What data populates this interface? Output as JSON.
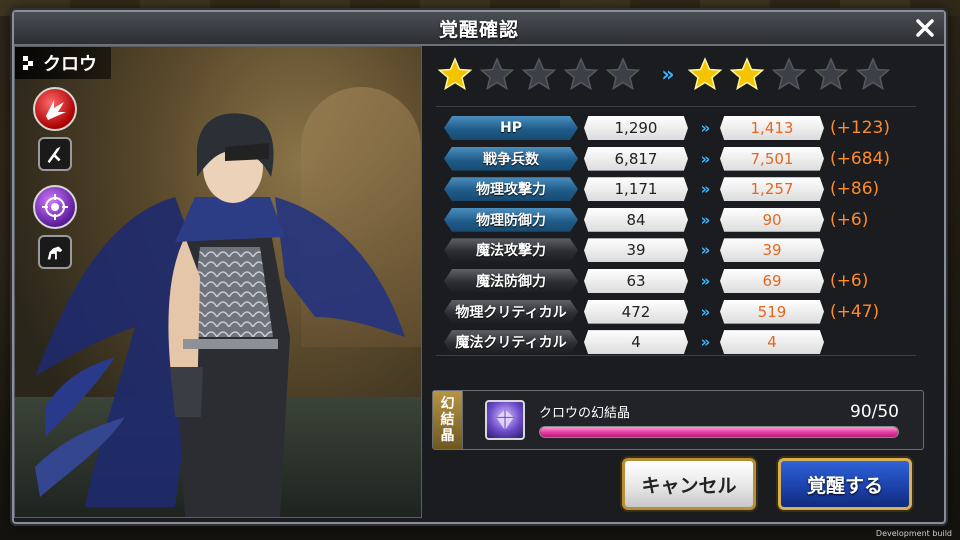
{
  "dialog": {
    "title": "覚醒確認"
  },
  "character": {
    "name": "クロウ",
    "role_icons": [
      "red-burst-icon",
      "purple-emblem-icon"
    ],
    "weapon_icons": [
      "weapon-swords-icon",
      "mount-horse-icon"
    ]
  },
  "rarity": {
    "current_filled": 1,
    "current_total": 5,
    "next_filled": 2,
    "next_total": 5,
    "arrow": "»"
  },
  "stats": [
    {
      "label": "HP",
      "style": "blue",
      "current": "1,290",
      "next": "1,413",
      "diff": "(+123)"
    },
    {
      "label": "戦争兵数",
      "style": "blue",
      "current": "6,817",
      "next": "7,501",
      "diff": "(+684)"
    },
    {
      "label": "物理攻撃力",
      "style": "blue",
      "current": "1,171",
      "next": "1,257",
      "diff": "(+86)"
    },
    {
      "label": "物理防御力",
      "style": "blue",
      "current": "84",
      "next": "90",
      "diff": "(+6)"
    },
    {
      "label": "魔法攻撃力",
      "style": "dark",
      "current": "39",
      "next": "39",
      "diff": ""
    },
    {
      "label": "魔法防御力",
      "style": "dark",
      "current": "63",
      "next": "69",
      "diff": "(+6)"
    },
    {
      "label": "物理クリティカル",
      "style": "dark",
      "current": "472",
      "next": "519",
      "diff": "(+47)"
    },
    {
      "label": "魔法クリティカル",
      "style": "dark",
      "current": "4",
      "next": "4",
      "diff": ""
    }
  ],
  "stat_arrow": "»",
  "crystal": {
    "tag_chars": [
      "幻",
      "結",
      "晶"
    ],
    "name": "クロウの幻結晶",
    "count": "90/50",
    "fill_fraction": 1.0
  },
  "buttons": {
    "cancel": "キャンセル",
    "awaken": "覚醒する"
  },
  "footer": "Development build",
  "colors": {
    "accent_blue": "#3ab8ff",
    "increase_orange": "#e8661d",
    "star_gold": "#f5c400",
    "bar_pink": "#e0349c"
  }
}
